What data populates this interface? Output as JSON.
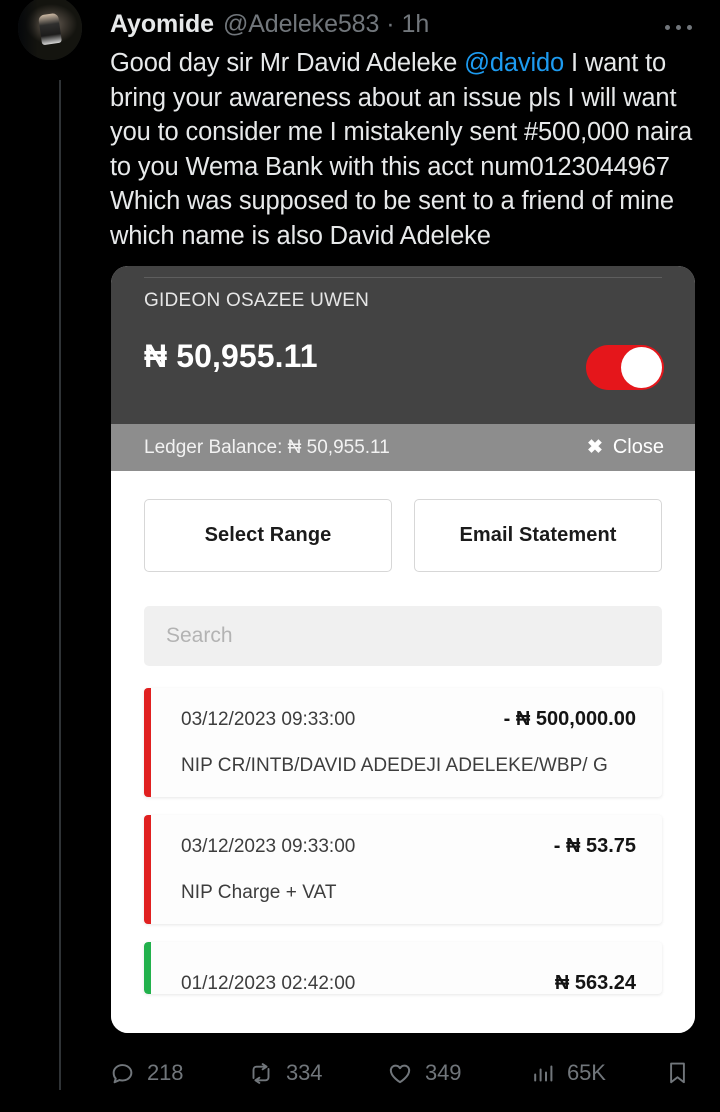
{
  "tweet": {
    "author": {
      "display_name": "Ayomide",
      "handle": "@Adeleke583",
      "avatar_icon": "profile-avatar-image"
    },
    "separator": "·",
    "timestamp": "1h",
    "more_icon": "more-options-icon",
    "body": {
      "part1": "Good day sir Mr David Adeleke ",
      "mention": "@davido",
      "part2": " I want to bring your awareness about an issue pls I will want you to consider me I mistakenly sent #500,000 naira to you Wema Bank with this acct num0123044967 Which was supposed to be sent to a friend of mine which name is also David Adeleke"
    }
  },
  "embed": {
    "account": {
      "name": "GIDEON OSAZEE UWEN",
      "balance": "₦ 50,955.11",
      "toggle_on": true,
      "toggle_color": "#e5161b"
    },
    "ledger": {
      "label": "Ledger Balance: ₦ 50,955.11",
      "close_icon": "close-x-icon",
      "close_label": "Close"
    },
    "buttons": {
      "select_range": "Select Range",
      "email_statement": "Email Statement"
    },
    "search": {
      "placeholder": "Search",
      "value": ""
    },
    "transactions": [
      {
        "date": "03/12/2023 09:33:00",
        "amount": "- ₦ 500,000.00",
        "description": "NIP CR/INTB/DAVID ADEDEJI ADELEKE/WBP/ G",
        "type": "debit",
        "stripe_color": "#e02020"
      },
      {
        "date": "03/12/2023 09:33:00",
        "amount": "- ₦ 53.75",
        "description": "NIP Charge + VAT",
        "type": "debit",
        "stripe_color": "#e02020"
      },
      {
        "date": "01/12/2023 02:42:00",
        "amount": "₦ 563.24",
        "description": "",
        "type": "credit",
        "stripe_color": "#22b14c"
      }
    ]
  },
  "actions": {
    "reply": {
      "icon": "reply-icon",
      "count": "218"
    },
    "retweet": {
      "icon": "retweet-icon",
      "count": "334"
    },
    "like": {
      "icon": "heart-icon",
      "count": "349"
    },
    "views": {
      "icon": "analytics-bars-icon",
      "count": "65K"
    },
    "bookmark": {
      "icon": "bookmark-icon"
    }
  }
}
